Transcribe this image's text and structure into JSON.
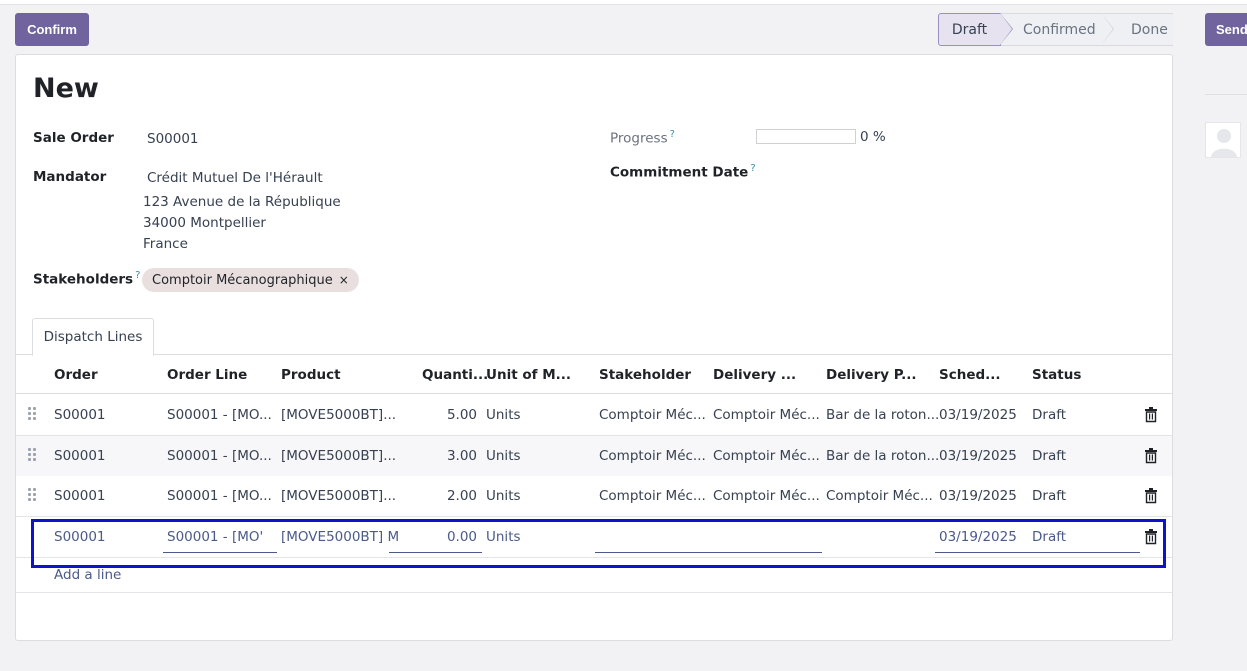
{
  "toolbar": {
    "confirm_label": "Confirm",
    "send_label": "Send",
    "stages": [
      "Draft",
      "Confirmed",
      "Done"
    ]
  },
  "record": {
    "title": "New",
    "sale_order_label": "Sale Order",
    "sale_order_value": "S00001",
    "mandator_label": "Mandator",
    "mandator_lines": [
      "Crédit Mutuel De l'Hérault",
      "123 Avenue de la République",
      "34000 Montpellier",
      "France"
    ],
    "stakeholders_label": "Stakeholders",
    "stakeholder_tag": "Comptoir Mécanographique",
    "tag_remove": "×",
    "progress_label": "Progress",
    "progress_value": "0 %",
    "progress_fraction": 0,
    "commitment_label": "Commitment Date",
    "help_mark": "?"
  },
  "tabs": [
    "Dispatch Lines"
  ],
  "table": {
    "columns": [
      "Order",
      "Order Line",
      "Product",
      "Quanti...",
      "Unit of M...",
      "Stakeholder",
      "Delivery ...",
      "Delivery P...",
      "Sched...",
      "Status"
    ],
    "rows": [
      [
        "S00001",
        "S00001 - [MO...",
        "[MOVE5000BT]...",
        "5.00",
        "Units",
        "Comptoir Méc...",
        "Comptoir Méc...",
        "Bar de la roton...",
        "03/19/2025",
        "Draft"
      ],
      [
        "S00001",
        "S00001 - [MO...",
        "[MOVE5000BT]...",
        "3.00",
        "Units",
        "Comptoir Méc...",
        "Comptoir Méc...",
        "Bar de la roton...",
        "03/19/2025",
        "Draft"
      ],
      [
        "S00001",
        "S00001 - [MO...",
        "[MOVE5000BT]...",
        "2.00",
        "Units",
        "Comptoir Méc...",
        "Comptoir Méc...",
        "Comptoir Méc...",
        "03/19/2025",
        "Draft"
      ]
    ],
    "edit_row": [
      "S00001",
      "S00001 - [MO'",
      "[MOVE5000BT] M",
      "0.00",
      "Units",
      "",
      "",
      "",
      "03/19/2025",
      "Draft"
    ],
    "add_line": "Add a line"
  },
  "colors": {
    "primary": "#71639e",
    "highlight_box": "#1010d0"
  }
}
